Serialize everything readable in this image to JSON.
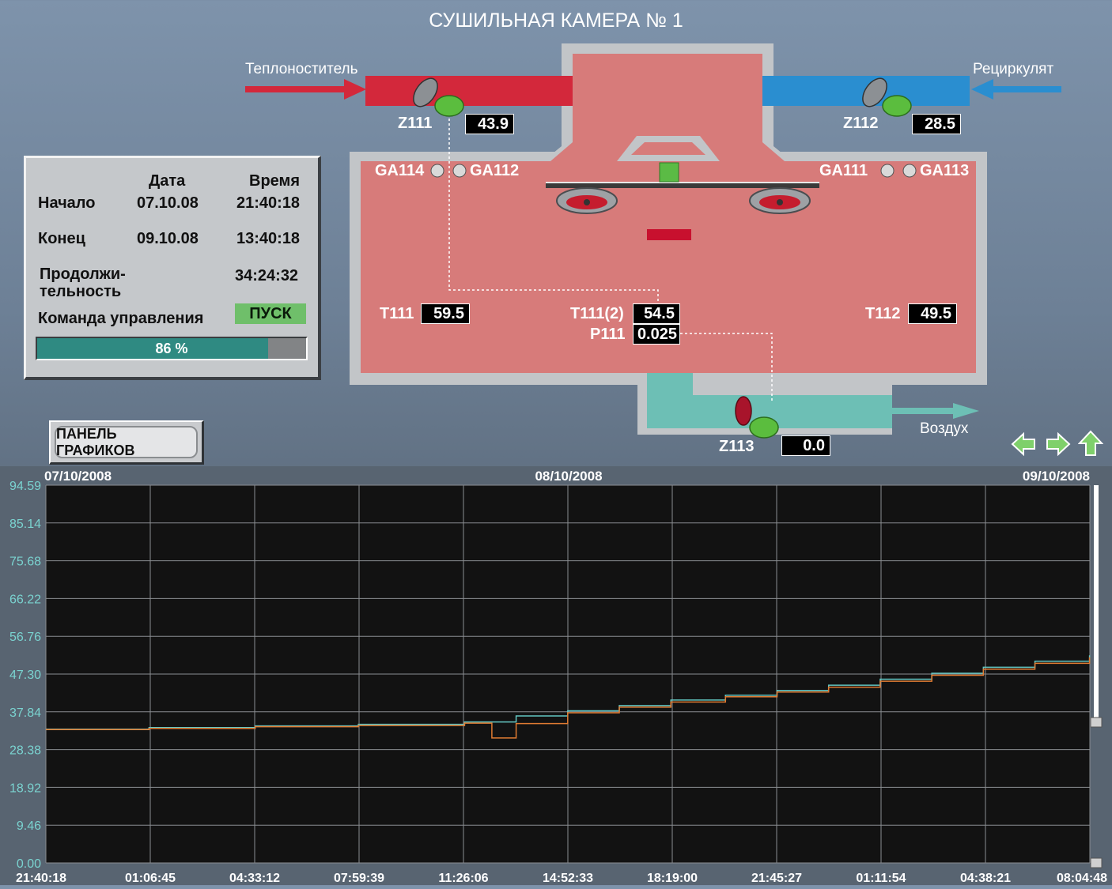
{
  "title": "СУШИЛЬНАЯ КАМЕРА № 1",
  "colors": {
    "chamber": "#d77b7a",
    "hot_pipe": "#d3283b",
    "recirc_pipe": "#2a8ed0",
    "exhaust": "#6dbfb5",
    "trend_bg": "#121212",
    "series_cyan": "#63c6c2",
    "series_orange": "#e07b32",
    "axis_text": "#7ad3d0"
  },
  "labels": {
    "heat_carrier": "Теплоноститель",
    "recirculate": "Рециркулят",
    "air": "Воздух"
  },
  "dampers": [
    {
      "tag": "Z111",
      "value": "43.9"
    },
    {
      "tag": "Z112",
      "value": "28.5"
    },
    {
      "tag": "Z113",
      "value": "0.0"
    }
  ],
  "sensors": {
    "ga114": "GA114",
    "ga112": "GA112",
    "ga111": "GA111",
    "ga113": "GA113",
    "t111": {
      "tag": "T111",
      "value": "59.5"
    },
    "t111_2": {
      "tag": "T111(2)",
      "value": "54.5"
    },
    "p111": {
      "tag": "P111",
      "value": "0.025"
    },
    "t112": {
      "tag": "T112",
      "value": "49.5"
    }
  },
  "info": {
    "col_date": "Дата",
    "col_time": "Время",
    "start_label": "Начало",
    "start_date": "07.10.08",
    "start_time": "21:40:18",
    "end_label": "Конец",
    "end_date": "09.10.08",
    "end_time": "13:40:18",
    "duration_label_1": "Продолжи-",
    "duration_label_2": "тельность",
    "duration_time": "34:24:32",
    "command_label": "Команда управления",
    "command_value": "ПУСК",
    "progress_text": "86 %",
    "progress_fraction": 0.86
  },
  "charts_button": "ПАНЕЛЬ ГРАФИКОВ",
  "nav": {
    "back": "arrow-left-icon",
    "forward": "arrow-right-icon",
    "up": "arrow-up-icon"
  },
  "chart_data": {
    "type": "line",
    "dates": [
      "07/10/2008",
      "08/10/2008",
      "09/10/2008"
    ],
    "x_tick_labels": [
      "21:40:18",
      "01:06:45",
      "04:33:12",
      "07:59:39",
      "11:26:06",
      "14:52:33",
      "18:19:00",
      "21:45:27",
      "01:11:54",
      "04:38:21",
      "08:04:48"
    ],
    "y_tick_labels": [
      "94.59",
      "85.14",
      "75.68",
      "66.22",
      "56.76",
      "47.30",
      "37.84",
      "28.38",
      "18.92",
      "9.46",
      "0.00"
    ],
    "ylim": [
      0,
      94.59
    ],
    "x_range_hours": [
      0,
      34.41
    ],
    "grid": true,
    "series": [
      {
        "color": "#63c6c2",
        "x": [
          0,
          3.4,
          6.9,
          10.3,
          13.8,
          15.5,
          17.2,
          18.9,
          20.6,
          22.4,
          24.1,
          25.8,
          27.5,
          29.2,
          30.9,
          32.6,
          34.4
        ],
        "y": [
          33.5,
          33.9,
          34.3,
          34.7,
          35.3,
          36.8,
          38.1,
          39.4,
          40.8,
          42.0,
          43.2,
          44.5,
          46.0,
          47.5,
          49.0,
          50.5,
          52.0
        ]
      },
      {
        "color": "#e07b32",
        "x": [
          0,
          3.4,
          6.9,
          10.3,
          13.8,
          14.7,
          15.5,
          17.2,
          18.9,
          20.6,
          22.4,
          24.1,
          25.8,
          27.5,
          29.2,
          30.9,
          32.6,
          34.4
        ],
        "y": [
          33.4,
          33.7,
          34.1,
          34.4,
          35.0,
          31.3,
          34.9,
          37.6,
          39.0,
          40.3,
          41.6,
          42.8,
          44.0,
          45.5,
          47.0,
          48.5,
          50.0,
          51.5
        ]
      }
    ]
  }
}
